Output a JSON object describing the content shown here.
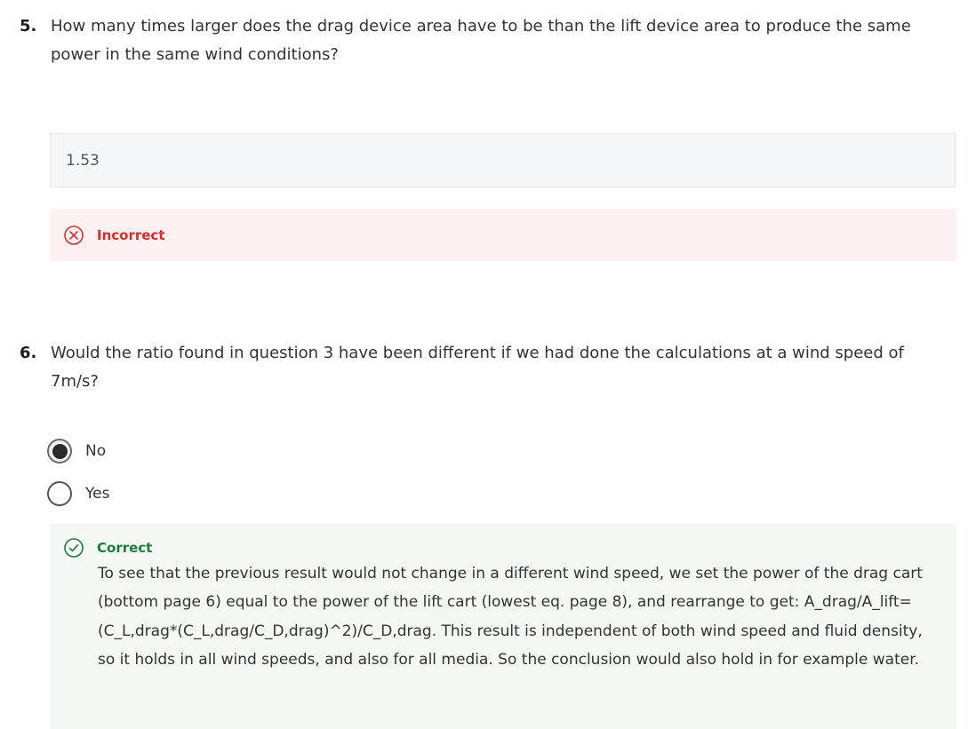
{
  "question5": {
    "number": "5.",
    "text": "How many times larger does the drag device area have to be than the lift device area to produce the same power in the same wind conditions?",
    "answer_value": "1.53",
    "feedback": {
      "status": "Incorrect",
      "icon": "x-circle-icon",
      "color": "#d32f2f"
    }
  },
  "question6": {
    "number": "6.",
    "text": "Would the ratio found in question 3 have been different if we had done the calculations at a wind speed of 7m/s?",
    "options": [
      {
        "label": "No",
        "selected": true
      },
      {
        "label": "Yes",
        "selected": false
      }
    ],
    "feedback": {
      "status": "Correct",
      "icon": "check-circle-icon",
      "color": "#1e7b3a",
      "explanation": "To see that the previous result would not change in a different wind speed, we set the power of the drag cart (bottom page 6) equal to the power of the lift cart (lowest eq. page 8), and rearrange to get: A_drag/A_lift=(C_L,drag*(C_L,drag/C_D,drag)^2)/C_D,drag. This result is independent of both wind speed and fluid density, so it holds in all wind speeds, and also for all media. So the conclusion would also hold in for example water."
    }
  }
}
